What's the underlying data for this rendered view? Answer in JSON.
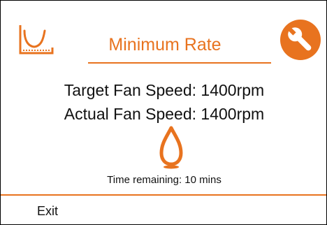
{
  "header": {
    "title": "Minimum Rate",
    "mode_icon": "minimum-rate-icon",
    "settings_icon": "wrench-icon"
  },
  "status": {
    "target_label": "Target Fan Speed: 1400rpm",
    "actual_label": "Actual Fan Speed: 1400rpm",
    "flame_icon": "flame-icon",
    "time_remaining": "Time remaining: 10 mins"
  },
  "footer": {
    "exit_label": "Exit"
  },
  "colors": {
    "accent": "#e8731f",
    "text": "#111111",
    "background": "#ffffff"
  }
}
